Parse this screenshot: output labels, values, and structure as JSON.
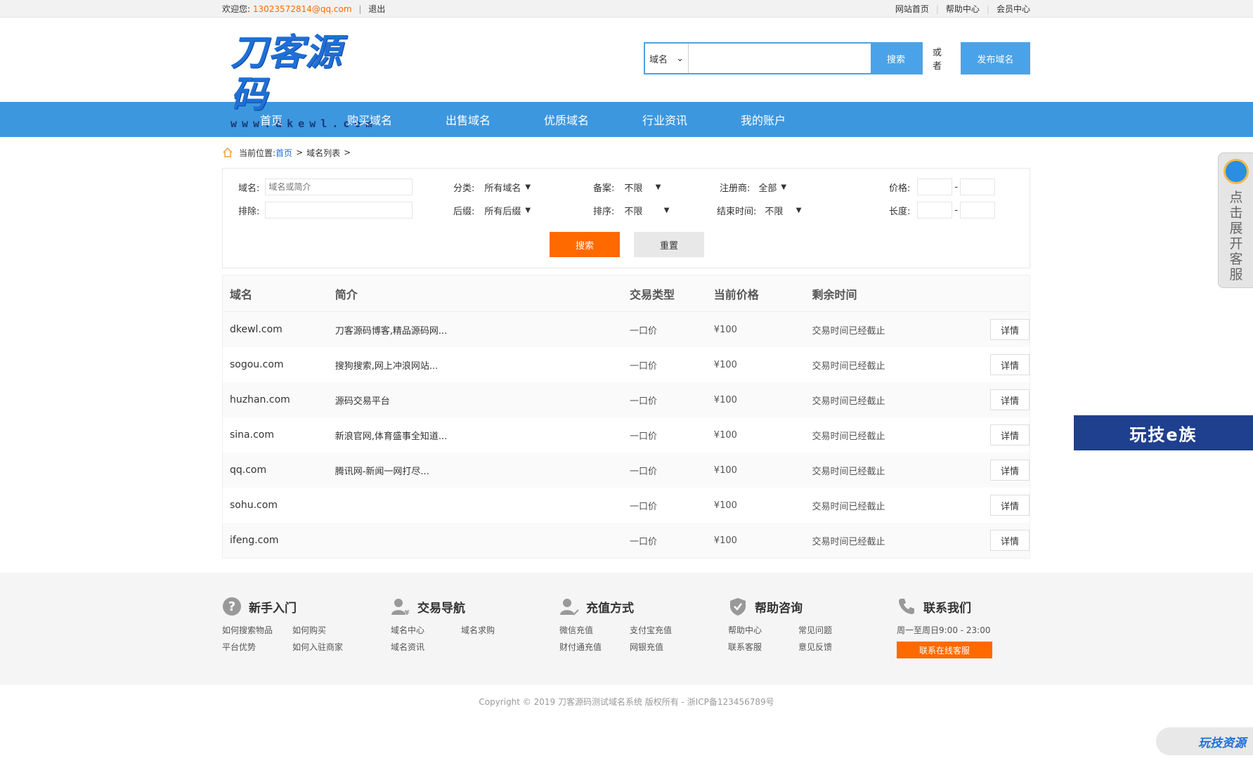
{
  "topbar": {
    "welcome": "欢迎您:",
    "email": "13023572814@qq.com",
    "separator": "|",
    "logout": "退出",
    "links": [
      "网站首页",
      "帮助中心",
      "会员中心"
    ]
  },
  "logo": {
    "title": "刀客源码",
    "subtitle": "www.dkewl.com"
  },
  "search": {
    "type": "域名",
    "placeholder": "",
    "button": "搜索",
    "or": "或者",
    "publish": "发布域名"
  },
  "nav": [
    "首页",
    "购买域名",
    "出售域名",
    "优质域名",
    "行业资讯",
    "我的账户"
  ],
  "breadcrumb": {
    "label": "当前位置:",
    "home": "首页",
    "current": "域名列表",
    "arrow": ">"
  },
  "filter": {
    "domain_label": "域名:",
    "domain_placeholder": "域名或简介",
    "exclude_label": "排除:",
    "category_label": "分类:",
    "category_value": "所有域名",
    "suffix_label": "后缀:",
    "suffix_value": "所有后缀",
    "record_label": "备案:",
    "record_value": "不限",
    "sort_label": "排序:",
    "sort_value": "不限",
    "registrar_label": "注册商:",
    "registrar_value": "全部",
    "end_label": "结束时间:",
    "end_value": "不限",
    "price_label": "价格:",
    "length_label": "长度:",
    "dash": "-",
    "search_button": "搜索",
    "reset_button": "重置"
  },
  "table": {
    "headers": [
      "域名",
      "简介",
      "交易类型",
      "当前价格",
      "剩余时间"
    ],
    "detail_label": "详情",
    "rows": [
      {
        "domain": "dkewl.com",
        "desc": "刀客源码博客,精品源码网...",
        "type": "一口价",
        "price": "¥100",
        "remain": "交易时间已经截止"
      },
      {
        "domain": "sogou.com",
        "desc": "搜狗搜索,网上冲浪网站...",
        "type": "一口价",
        "price": "¥100",
        "remain": "交易时间已经截止"
      },
      {
        "domain": "huzhan.com",
        "desc": "源码交易平台",
        "type": "一口价",
        "price": "¥100",
        "remain": "交易时间已经截止"
      },
      {
        "domain": "sina.com",
        "desc": "新浪官网,体育盛事全知道...",
        "type": "一口价",
        "price": "¥100",
        "remain": "交易时间已经截止"
      },
      {
        "domain": "qq.com",
        "desc": "腾讯网-新闻一网打尽...",
        "type": "一口价",
        "price": "¥100",
        "remain": "交易时间已经截止"
      },
      {
        "domain": "sohu.com",
        "desc": "",
        "type": "一口价",
        "price": "¥100",
        "remain": "交易时间已经截止"
      },
      {
        "domain": "ifeng.com",
        "desc": "",
        "type": "一口价",
        "price": "¥100",
        "remain": "交易时间已经截止"
      }
    ]
  },
  "footer": {
    "cols": [
      {
        "title": "新手入门",
        "icon": "question-icon",
        "links": [
          "如何搜索物品",
          "如何购买",
          "平台优势",
          "如何入驻商家"
        ]
      },
      {
        "title": "交易导航",
        "icon": "user-yen-icon",
        "links": [
          "域名中心",
          "域名求购",
          "域名资讯"
        ]
      },
      {
        "title": "充值方式",
        "icon": "user-pen-icon",
        "links": [
          "微信充值",
          "支付宝充值",
          "财付通充值",
          "网银充值"
        ]
      },
      {
        "title": "帮助咨询",
        "icon": "shield-icon",
        "links": [
          "帮助中心",
          "常见问题",
          "联系客服",
          "意见反馈"
        ]
      }
    ],
    "contact": {
      "title": "联系我们",
      "icon": "phone-icon",
      "hours": "周一至周日9:00 - 23:00",
      "button": "联系在线客服"
    },
    "copyright": "Copyright © 2019 刀客源码测试域名系统 版权所有 - 浙ICP备123456789号"
  },
  "float": {
    "kefu": "点击展开客服",
    "ad": "玩技e族",
    "watermark": "玩技资源"
  },
  "colors": {
    "primary": "#3d97de",
    "accent": "#ff6a00",
    "logo": "#1f6fd6"
  }
}
